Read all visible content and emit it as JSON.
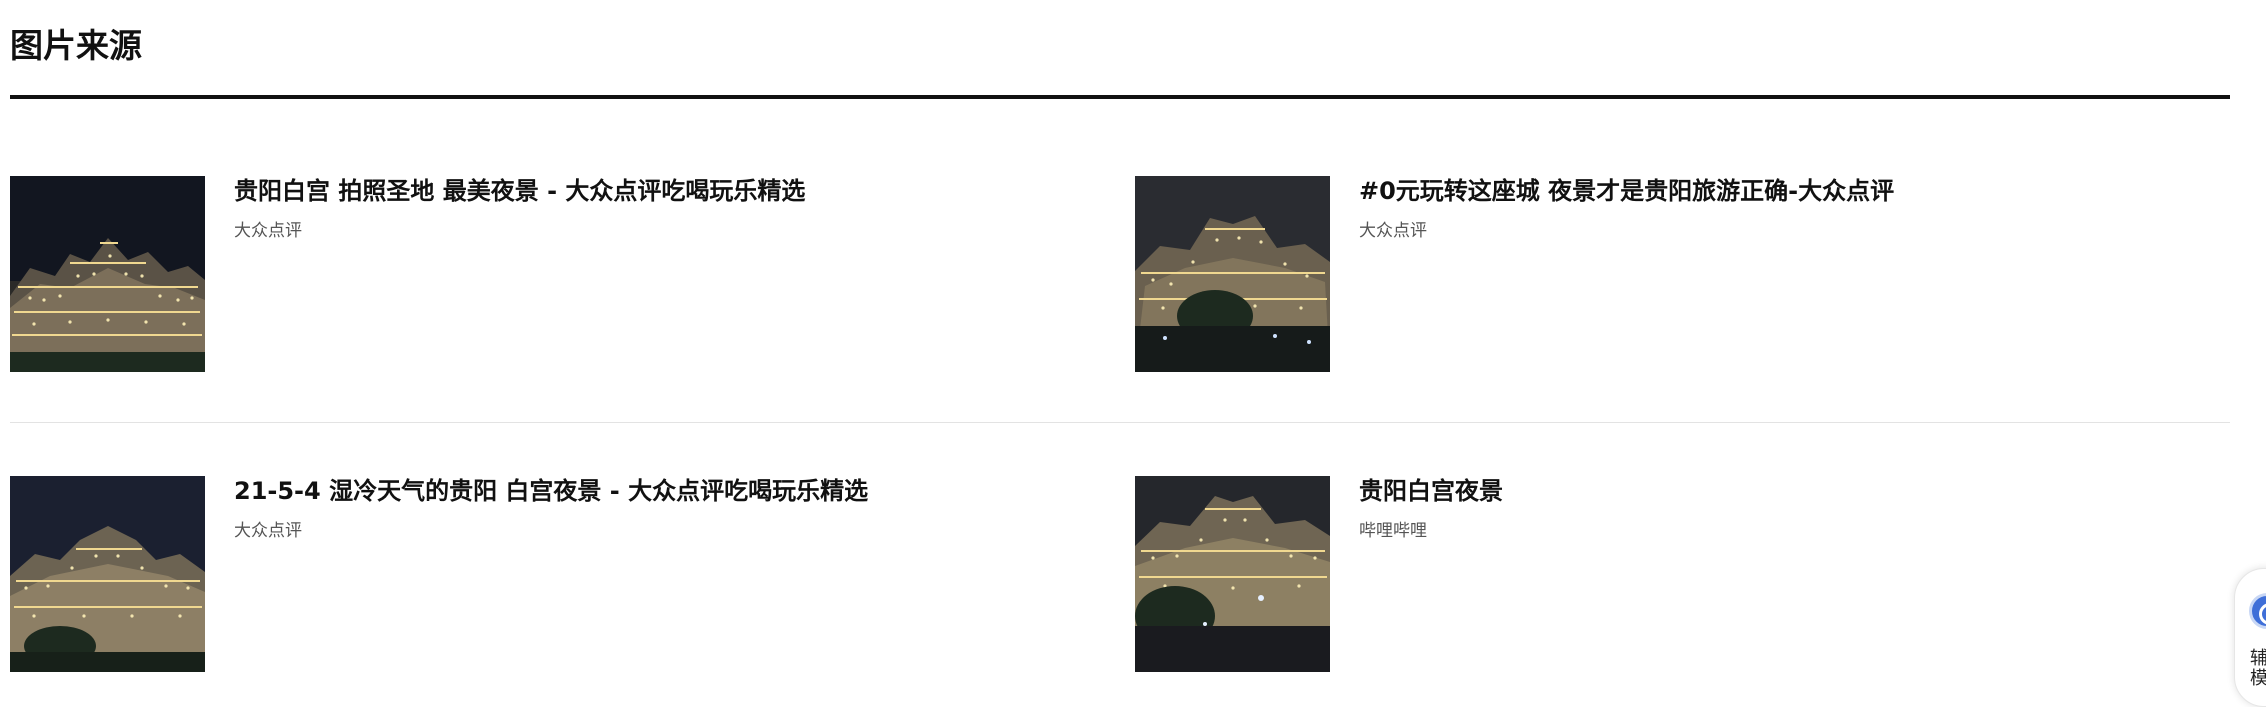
{
  "section": {
    "title": "图片来源"
  },
  "results": [
    {
      "title": "贵阳白宫 拍照圣地 最美夜景 - 大众点评吃喝玩乐精选",
      "source": "大众点评"
    },
    {
      "title": "#0元玩转这座城 夜景才是贵阳旅游正确-大众点评",
      "source": "大众点评"
    },
    {
      "title": "21-5-4 湿冷天气的贵阳 白宫夜景 - 大众点评吃喝玩乐精选",
      "source": "大众点评"
    },
    {
      "title": "贵阳白宫夜景",
      "source": "哔哩哔哩"
    }
  ],
  "assist_widget": {
    "label": "辅模",
    "icon": "accessibility-icon"
  },
  "colors": {
    "title_rule": "#111111",
    "divider": "#e3e3e3",
    "source_text": "#555555",
    "thumb_sky": "#141821",
    "thumb_lights": "#f0d890"
  }
}
